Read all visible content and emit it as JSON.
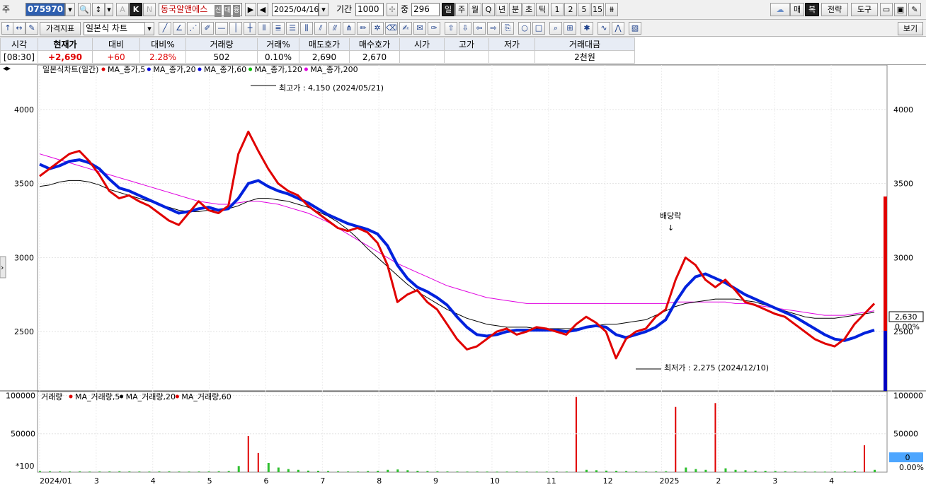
{
  "toolbar": {
    "market_label": "주",
    "code_value": "075970",
    "stock_name": "동국알앤에스",
    "date_value": "2025/04/16",
    "period_label": "기간",
    "period_value": "1000",
    "count_label": "중",
    "count_value": "296",
    "k_label": "K",
    "a_label": "A",
    "n_label": "N",
    "badges": [
      "신",
      "대",
      "융"
    ],
    "period_buttons": [
      "일",
      "주",
      "월",
      "Q",
      "년",
      "분",
      "초",
      "틱",
      "1",
      "2",
      "5",
      "15"
    ],
    "right_buttons": [
      "매",
      "복",
      "전략",
      "도구"
    ]
  },
  "toolbar2": {
    "indicator_label": "가격지표",
    "chart_type_value": "일본식 차트",
    "view_label": "보기"
  },
  "info": {
    "headers": [
      "시각",
      "현재가",
      "대비",
      "대비%",
      "거래량",
      "거래%",
      "매도호가",
      "매수호가",
      "시가",
      "고가",
      "저가",
      "거래대금"
    ],
    "values": [
      "[08:30]",
      "+2,690",
      "+60",
      "2.28%",
      "502",
      "0.10%",
      "2,690",
      "2,670",
      "",
      "",
      "",
      "2천원"
    ]
  },
  "chart_data": {
    "type": "line",
    "title": "일본식차트(일간)",
    "legend": [
      {
        "name": "MA_종가,5",
        "color": "#e00000"
      },
      {
        "name": "MA_종가,20",
        "color": "#0000e0"
      },
      {
        "name": "MA_종가,60",
        "color": "#0000e0"
      },
      {
        "name": "MA_종가,120",
        "color": "#00c000"
      },
      {
        "name": "MA_종가,200",
        "color": "#e000e0"
      }
    ],
    "ylim": [
      2100,
      4300
    ],
    "y_ticks": [
      2500,
      3000,
      3500,
      4000
    ],
    "x_ticks": [
      "2024/01",
      "3",
      "4",
      "5",
      "6",
      "7",
      "8",
      "9",
      "10",
      "11",
      "12",
      "2025",
      "2",
      "3",
      "4"
    ],
    "price": [
      3550,
      3600,
      3650,
      3700,
      3720,
      3650,
      3560,
      3450,
      3400,
      3420,
      3380,
      3350,
      3300,
      3250,
      3220,
      3300,
      3380,
      3320,
      3300,
      3350,
      3700,
      3850,
      3720,
      3600,
      3500,
      3450,
      3420,
      3350,
      3300,
      3250,
      3200,
      3180,
      3200,
      3170,
      3100,
      2950,
      2700,
      2750,
      2780,
      2700,
      2650,
      2550,
      2450,
      2380,
      2400,
      2450,
      2500,
      2520,
      2480,
      2500,
      2530,
      2520,
      2500,
      2480,
      2550,
      2600,
      2560,
      2500,
      2320,
      2450,
      2500,
      2520,
      2600,
      2650,
      2850,
      3000,
      2950,
      2850,
      2800,
      2850,
      2780,
      2700,
      2680,
      2650,
      2620,
      2600,
      2550,
      2500,
      2450,
      2420,
      2400,
      2450,
      2550,
      2620,
      2690
    ],
    "ma60": [
      3630,
      3600,
      3620,
      3650,
      3660,
      3640,
      3600,
      3530,
      3470,
      3450,
      3420,
      3390,
      3360,
      3330,
      3300,
      3310,
      3330,
      3340,
      3320,
      3330,
      3400,
      3500,
      3520,
      3480,
      3450,
      3430,
      3400,
      3370,
      3330,
      3290,
      3260,
      3230,
      3210,
      3190,
      3160,
      3080,
      2950,
      2860,
      2800,
      2770,
      2730,
      2680,
      2600,
      2530,
      2480,
      2470,
      2480,
      2500,
      2510,
      2510,
      2510,
      2510,
      2510,
      2500,
      2510,
      2530,
      2540,
      2530,
      2480,
      2460,
      2480,
      2500,
      2530,
      2580,
      2700,
      2800,
      2870,
      2890,
      2860,
      2830,
      2790,
      2750,
      2720,
      2690,
      2660,
      2630,
      2600,
      2560,
      2520,
      2480,
      2450,
      2440,
      2460,
      2490,
      2510
    ],
    "ma120": [
      3480,
      3490,
      3510,
      3520,
      3520,
      3510,
      3490,
      3460,
      3440,
      3420,
      3400,
      3380,
      3360,
      3340,
      3320,
      3310,
      3310,
      3320,
      3320,
      3330,
      3350,
      3380,
      3400,
      3400,
      3390,
      3380,
      3360,
      3340,
      3310,
      3280,
      3240,
      3190,
      3130,
      3060,
      3000,
      2940,
      2880,
      2820,
      2770,
      2730,
      2690,
      2650,
      2620,
      2590,
      2570,
      2550,
      2540,
      2530,
      2530,
      2530,
      2520,
      2520,
      2520,
      2520,
      2520,
      2530,
      2540,
      2550,
      2550,
      2560,
      2570,
      2580,
      2610,
      2640,
      2670,
      2690,
      2700,
      2710,
      2720,
      2720,
      2720,
      2710,
      2700,
      2680,
      2660,
      2640,
      2620,
      2600,
      2590,
      2590,
      2590,
      2600,
      2610,
      2620,
      2630
    ],
    "ma200": [
      3700,
      3680,
      3660,
      3640,
      3620,
      3600,
      3580,
      3560,
      3540,
      3520,
      3500,
      3480,
      3460,
      3440,
      3420,
      3400,
      3380,
      3370,
      3360,
      3360,
      3370,
      3380,
      3380,
      3370,
      3360,
      3340,
      3320,
      3300,
      3270,
      3240,
      3200,
      3160,
      3120,
      3080,
      3040,
      3000,
      2960,
      2930,
      2900,
      2870,
      2840,
      2810,
      2790,
      2770,
      2750,
      2730,
      2720,
      2710,
      2700,
      2690,
      2690,
      2690,
      2690,
      2690,
      2690,
      2690,
      2690,
      2690,
      2690,
      2690,
      2690,
      2690,
      2690,
      2690,
      2700,
      2700,
      2700,
      2700,
      2700,
      2700,
      2690,
      2690,
      2680,
      2670,
      2660,
      2650,
      2640,
      2630,
      2620,
      2610,
      2610,
      2610,
      2620,
      2630,
      2640
    ],
    "annotations": {
      "high": "최고가 : 4,150 (2024/05/21)",
      "low": "최저가 : 2,275 (2024/12/10)",
      "dividend": "배당락"
    },
    "current_price": "2,630",
    "current_pct": "0.00%"
  },
  "volume_chart": {
    "title": "거래량",
    "legend": [
      {
        "name": "MA_거래량,5",
        "color": "#e00000"
      },
      {
        "name": "MA_거래량,20",
        "color": "#000000"
      },
      {
        "name": "MA_거래량,60",
        "color": "#e00000"
      }
    ],
    "ylim": [
      0,
      105000
    ],
    "y_ticks": [
      50000,
      100000
    ],
    "unit_label": "*100",
    "right_value": "0",
    "right_pct": "0.00%",
    "values": [
      1500,
      1200,
      1000,
      900,
      1100,
      800,
      900,
      1000,
      1200,
      1000,
      900,
      800,
      1000,
      1100,
      900,
      800,
      900,
      1000,
      1200,
      1500,
      8000,
      47000,
      25000,
      12000,
      6000,
      4000,
      3000,
      2000,
      1800,
      1500,
      1200,
      1000,
      900,
      1500,
      1800,
      3000,
      3500,
      2500,
      1800,
      1500,
      1200,
      1000,
      900,
      800,
      900,
      800,
      700,
      800,
      900,
      800,
      700,
      800,
      900,
      800,
      98000,
      3000,
      2500,
      2000,
      1800,
      1500,
      1200,
      1000,
      1100,
      1200,
      85000,
      6000,
      4000,
      3000,
      90000,
      5000,
      3000,
      2500,
      2000,
      1800,
      1500,
      1200,
      1000,
      900,
      800,
      700,
      800,
      900,
      1500,
      35000,
      3000
    ]
  }
}
